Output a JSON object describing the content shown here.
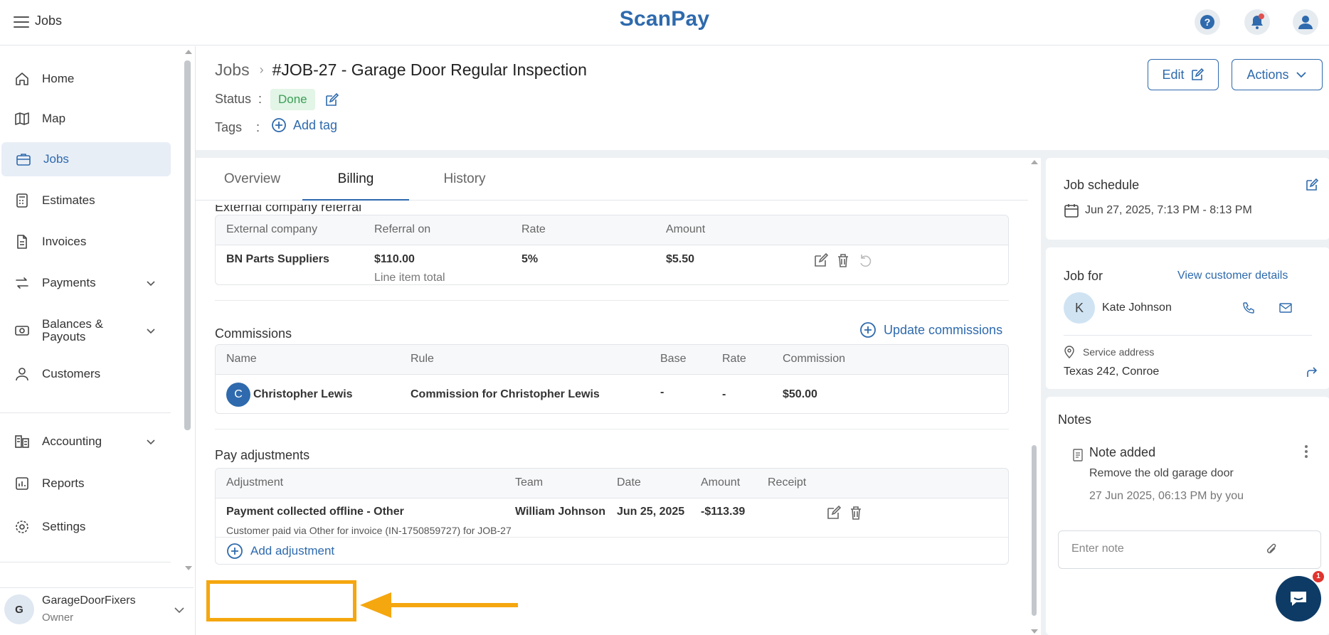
{
  "topbar": {
    "title": "Jobs",
    "brand": "ScanPay"
  },
  "sidebar": {
    "items": [
      {
        "label": "Home"
      },
      {
        "label": "Map"
      },
      {
        "label": "Jobs"
      },
      {
        "label": "Estimates"
      },
      {
        "label": "Invoices"
      },
      {
        "label": "Payments"
      },
      {
        "label": "Balances &"
      },
      {
        "label": "Payouts"
      },
      {
        "label": "Customers"
      },
      {
        "label": "Accounting"
      },
      {
        "label": "Reports"
      },
      {
        "label": "Settings"
      }
    ],
    "user": {
      "initial": "G",
      "name": "GarageDoorFixers",
      "role": "Owner"
    }
  },
  "header": {
    "breadcrumb_root": "Jobs",
    "title": "#JOB-27 - Garage Door Regular Inspection",
    "status_label": "Status",
    "status_value": "Done",
    "tags_label": "Tags",
    "colon": ":",
    "add_tag": "Add tag",
    "edit_button": "Edit",
    "actions_button": "Actions"
  },
  "tabs": [
    {
      "label": "Overview"
    },
    {
      "label": "Billing"
    },
    {
      "label": "History"
    }
  ],
  "referral": {
    "title": "External company referral",
    "headers": [
      "External company",
      "Referral on",
      "Rate",
      "Amount"
    ],
    "row": {
      "company": "BN Parts Suppliers",
      "referral_on": "$110.00",
      "referral_sub": "Line item total",
      "rate": "5%",
      "amount": "$5.50"
    }
  },
  "commissions": {
    "title": "Commissions",
    "update_button": "Update commissions",
    "headers": [
      "Name",
      "Rule",
      "Base",
      "Rate",
      "Commission"
    ],
    "row": {
      "initial": "C",
      "name": "Christopher Lewis",
      "rule": "Commission for Christopher Lewis",
      "base": "-",
      "rate": "-",
      "commission": "$50.00"
    }
  },
  "pay_adjustments": {
    "title": "Pay adjustments",
    "headers": [
      "Adjustment",
      "Team",
      "Date",
      "Amount",
      "Receipt"
    ],
    "row": {
      "adjustment": "Payment collected offline - Other",
      "team": "William Johnson",
      "date": "Jun 25, 2025",
      "amount": "-$113.39",
      "note": "Customer paid via Other for invoice (IN-1750859727) for JOB-27"
    },
    "add_button": "Add adjustment"
  },
  "job_schedule": {
    "title": "Job schedule",
    "value": "Jun 27, 2025, 7:13 PM - 8:13 PM"
  },
  "job_for": {
    "title": "Job for",
    "view_link": "View customer details",
    "initial": "K",
    "customer": "Kate Johnson",
    "address_label": "Service address",
    "address": "Texas 242, Conroe"
  },
  "notes": {
    "title": "Notes",
    "note_title": "Note added",
    "note_body": "Remove the old garage door",
    "note_meta": "27 Jun 2025, 06:13 PM by you",
    "input_placeholder": "Enter note"
  },
  "chat": {
    "badge": "1"
  },
  "colors": {
    "brand": "#2e6aad",
    "status_green": "#3a9e55",
    "highlight": "#f5a70f"
  }
}
